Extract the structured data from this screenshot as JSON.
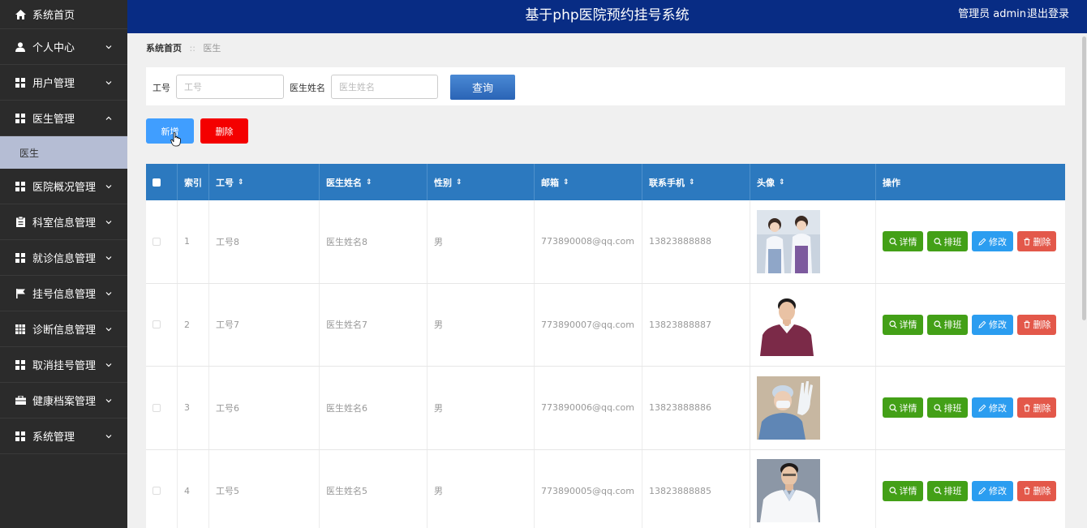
{
  "header": {
    "title": "基于php医院预约挂号系统",
    "user": "管理员 admin",
    "logout": "退出登录"
  },
  "sidebar": {
    "items": [
      {
        "label": "系统首页",
        "icon": "home-icon"
      },
      {
        "label": "个人中心",
        "icon": "user-icon"
      },
      {
        "label": "用户管理",
        "icon": "grid-icon"
      },
      {
        "label": "医生管理",
        "icon": "grid-icon",
        "expanded": true
      },
      {
        "label": "医院概况管理",
        "icon": "grid-icon"
      },
      {
        "label": "科室信息管理",
        "icon": "clipboard-icon"
      },
      {
        "label": "就诊信息管理",
        "icon": "grid-icon"
      },
      {
        "label": "挂号信息管理",
        "icon": "flag-icon"
      },
      {
        "label": "诊断信息管理",
        "icon": "table-icon"
      },
      {
        "label": "取消挂号管理",
        "icon": "grid-icon"
      },
      {
        "label": "健康档案管理",
        "icon": "briefcase-icon"
      },
      {
        "label": "系统管理",
        "icon": "grid-icon"
      }
    ],
    "sub_item": "医生"
  },
  "breadcrumb": {
    "home": "系统首页",
    "sep": "::",
    "current": "医生"
  },
  "search": {
    "label_id": "工号",
    "placeholder_id": "工号",
    "label_name": "医生姓名",
    "placeholder_name": "医生姓名",
    "query_button": "查询"
  },
  "actions": {
    "add": "新增",
    "delete": "删除"
  },
  "table": {
    "headers": {
      "index": "索引",
      "id": "工号",
      "name": "医生姓名",
      "gender": "性别",
      "email": "邮箱",
      "phone": "联系手机",
      "avatar": "头像",
      "ops": "操作"
    },
    "rows": [
      {
        "index": "1",
        "id": "工号8",
        "name": "医生姓名8",
        "gender": "男",
        "email": "773890008@qq.com",
        "phone": "13823888888",
        "avatar": "two-nurses-photo"
      },
      {
        "index": "2",
        "id": "工号7",
        "name": "医生姓名7",
        "gender": "男",
        "email": "773890007@qq.com",
        "phone": "13823888887",
        "avatar": "man-purple-sweater-photo"
      },
      {
        "index": "3",
        "id": "工号6",
        "name": "医生姓名6",
        "gender": "男",
        "email": "773890006@qq.com",
        "phone": "13823888886",
        "avatar": "surgeon-gloves-photo"
      },
      {
        "index": "4",
        "id": "工号5",
        "name": "医生姓名5",
        "gender": "男",
        "email": "773890005@qq.com",
        "phone": "13823888885",
        "avatar": "doctor-white-coat-photo"
      }
    ],
    "ops": {
      "detail": "详情",
      "schedule": "排班",
      "edit": "修改",
      "remove": "删除"
    }
  },
  "colors": {
    "header_bg": "#082c84",
    "sidebar_bg": "#2b2b2b",
    "table_head": "#2c79bf",
    "green": "#43a017",
    "blue": "#2b9df0",
    "red": "#e3584a"
  }
}
